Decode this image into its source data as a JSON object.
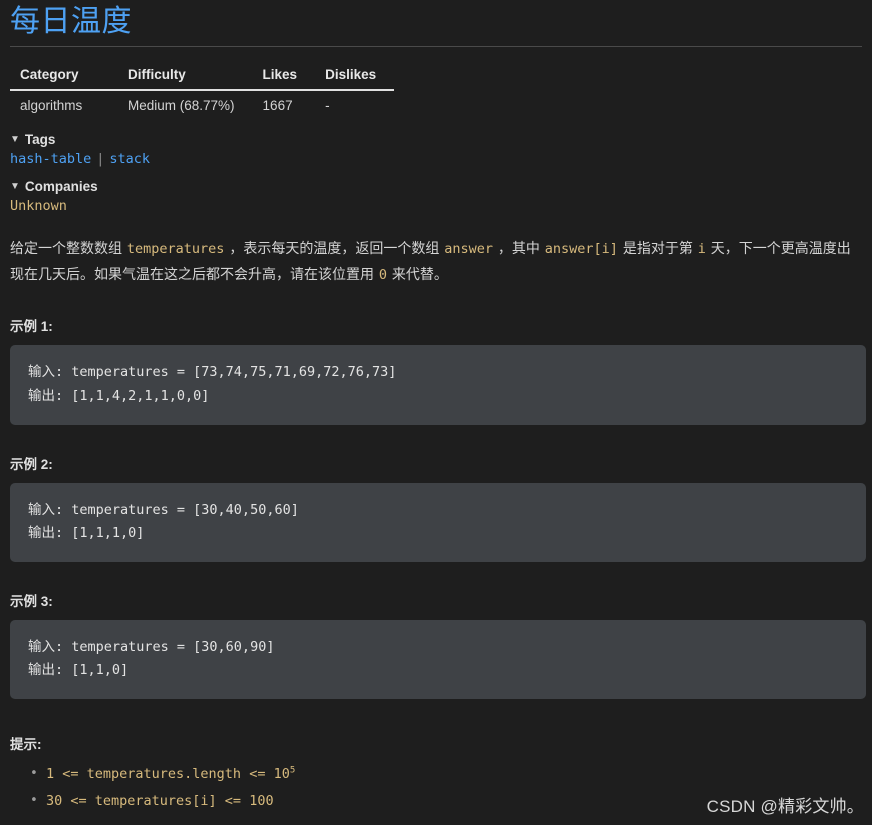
{
  "page": {
    "title": "每日温度",
    "background_color": "#1e1e1e",
    "accent_color": "#4ea1f3",
    "code_color": "#d7ba7d"
  },
  "meta_table": {
    "headers": [
      "Category",
      "Difficulty",
      "Likes",
      "Dislikes"
    ],
    "rows": [
      {
        "category": "algorithms",
        "difficulty": "Medium (68.77%)",
        "likes": "1667",
        "dislikes": "-"
      }
    ]
  },
  "tags_section": {
    "caret": "▼",
    "label": "Tags",
    "items": [
      "hash-table",
      "stack"
    ],
    "separator": "|"
  },
  "companies_section": {
    "caret": "▼",
    "label": "Companies",
    "value": "Unknown"
  },
  "description": {
    "part1": "给定一个整数数组 ",
    "code1": "temperatures",
    "part2": " ，表示每天的温度，返回一个数组 ",
    "code2": "answer",
    "part3": " ，其中 ",
    "code3": "answer[i]",
    "part4": " 是指对于第 ",
    "code4": "i",
    "part5": " 天，下一个更高温度出现在几天后。如果气温在这之后都不会升高，请在该位置用 ",
    "code5": "0",
    "part6": " 来代替。"
  },
  "examples": [
    {
      "title": "示例 1:",
      "code": "输入: temperatures = [73,74,75,71,69,72,76,73]\n输出: [1,1,4,2,1,1,0,0]",
      "input_array": [
        73,
        74,
        75,
        71,
        69,
        72,
        76,
        73
      ],
      "output_array": [
        1,
        1,
        4,
        2,
        1,
        1,
        0,
        0
      ]
    },
    {
      "title": "示例 2:",
      "code": "输入: temperatures = [30,40,50,60]\n输出: [1,1,1,0]",
      "input_array": [
        30,
        40,
        50,
        60
      ],
      "output_array": [
        1,
        1,
        1,
        0
      ]
    },
    {
      "title": "示例 3:",
      "code": "输入: temperatures = [30,60,90]\n输出: [1,1,0]",
      "input_array": [
        30,
        60,
        90
      ],
      "output_array": [
        1,
        1,
        0
      ]
    }
  ],
  "hints": {
    "title": "提示:",
    "items": [
      {
        "prefix": "1 <= temperatures.length <= 10",
        "sup": "5"
      },
      {
        "prefix": "30 <= temperatures[i] <= 100",
        "sup": ""
      }
    ]
  },
  "watermark": "CSDN @精彩文帅。"
}
